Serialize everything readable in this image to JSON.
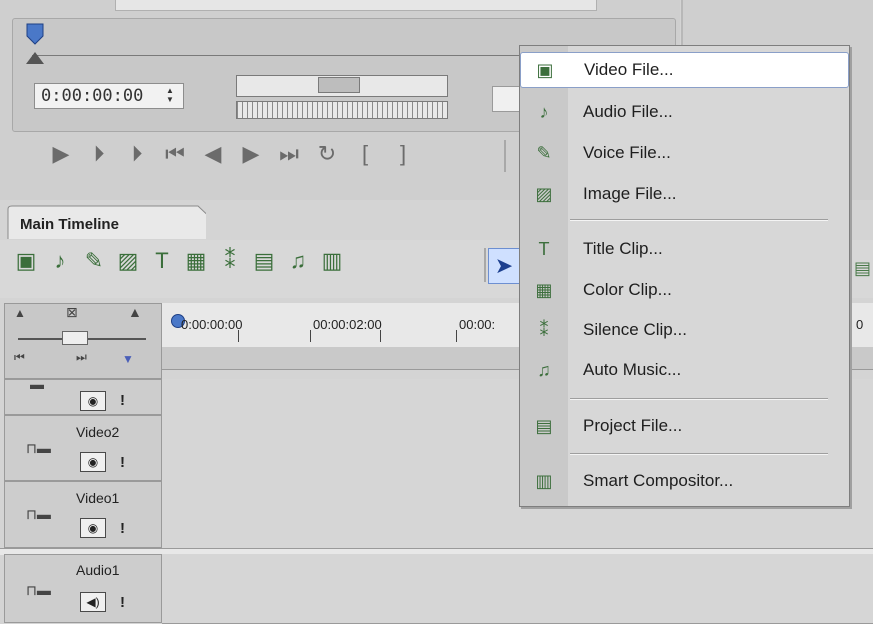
{
  "preview": {
    "timecode": "0:00:00:00",
    "timecode_spinner": "⬍"
  },
  "transport": {
    "buttons": [
      {
        "name": "play-icon",
        "glyph": "▶"
      },
      {
        "name": "play-range-icon",
        "glyph": "⏵"
      },
      {
        "name": "play-from-start-icon",
        "glyph": "⏵"
      },
      {
        "name": "go-to-start-icon",
        "glyph": "⏮"
      },
      {
        "name": "previous-frame-icon",
        "glyph": "◀"
      },
      {
        "name": "next-frame-icon",
        "glyph": "▶"
      },
      {
        "name": "go-to-end-icon",
        "glyph": "⏭"
      },
      {
        "name": "loop-icon",
        "glyph": "↻"
      },
      {
        "name": "mark-in-icon",
        "glyph": "["
      },
      {
        "name": "mark-out-icon",
        "glyph": "]"
      }
    ]
  },
  "timeline": {
    "tab_label": "Main Timeline",
    "toolbar_icons": [
      {
        "name": "add-video-file-icon",
        "glyph": "▣"
      },
      {
        "name": "add-audio-file-icon",
        "glyph": "♪"
      },
      {
        "name": "add-voice-file-icon",
        "glyph": "✎"
      },
      {
        "name": "add-image-file-icon",
        "glyph": "▨"
      },
      {
        "name": "add-title-clip-icon",
        "glyph": "T"
      },
      {
        "name": "add-color-clip-icon",
        "glyph": "▦"
      },
      {
        "name": "add-silence-clip-icon",
        "glyph": "⁑"
      },
      {
        "name": "add-project-file-icon",
        "glyph": "▤"
      },
      {
        "name": "add-auto-music-icon",
        "glyph": "♫"
      },
      {
        "name": "smart-compositor-icon",
        "glyph": "▥"
      }
    ],
    "ruler": {
      "labels": [
        "0:00:00:00",
        "00:00:02:00",
        "00:00:",
        "0"
      ]
    },
    "tracks": [
      {
        "name": "",
        "type": "video"
      },
      {
        "name": "Video2",
        "type": "video"
      },
      {
        "name": "Video1",
        "type": "video"
      },
      {
        "name": "Audio1",
        "type": "audio"
      }
    ],
    "track_flag": "!"
  },
  "context_menu": {
    "items": [
      {
        "label": "Video File...",
        "icon": "video-file-icon",
        "glyph": "▣",
        "highlighted": true
      },
      {
        "label": "Audio File...",
        "icon": "audio-file-icon",
        "glyph": "♪"
      },
      {
        "label": "Voice File...",
        "icon": "voice-file-icon",
        "glyph": "✎"
      },
      {
        "label": "Image File...",
        "icon": "image-file-icon",
        "glyph": "▨"
      },
      {
        "label": "Title Clip...",
        "icon": "title-clip-icon",
        "glyph": "T"
      },
      {
        "label": "Color Clip...",
        "icon": "color-clip-icon",
        "glyph": "▦"
      },
      {
        "label": "Silence Clip...",
        "icon": "silence-clip-icon",
        "glyph": "⁑"
      },
      {
        "label": "Auto Music...",
        "icon": "auto-music-icon",
        "glyph": "♫"
      },
      {
        "label": "Project File...",
        "icon": "project-file-icon",
        "glyph": "▤"
      },
      {
        "label": "Smart Compositor...",
        "icon": "smart-compositor-icon",
        "glyph": "▥"
      }
    ]
  },
  "colors": {
    "accent": "#4a78c8",
    "highlight": "#ffffff"
  }
}
